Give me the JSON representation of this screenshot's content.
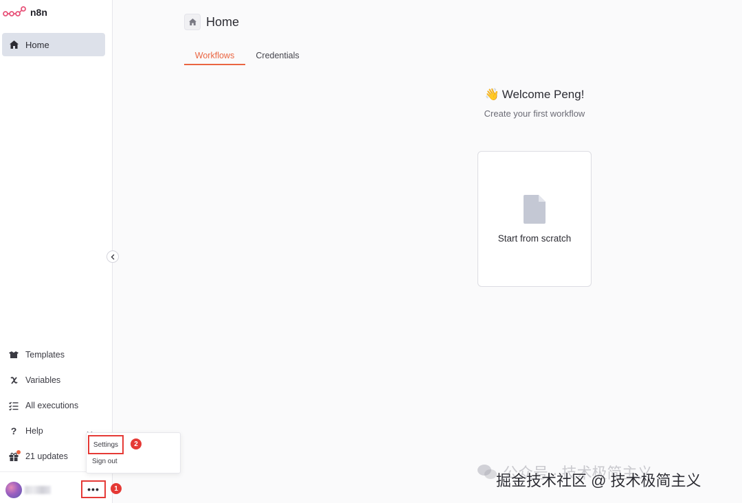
{
  "brand": {
    "name": "n8n",
    "accent": "#ea6541",
    "logo_color": "#e8547a"
  },
  "sidebar": {
    "home_label": "Home",
    "bottom_items": [
      {
        "label": "Templates",
        "icon": "box-icon"
      },
      {
        "label": "Variables",
        "icon": "variable-icon"
      },
      {
        "label": "All executions",
        "icon": "list-check-icon"
      },
      {
        "label": "Help",
        "icon": "question-icon"
      },
      {
        "label": "21 updates",
        "icon": "gift-icon"
      }
    ],
    "more_label": "•••"
  },
  "user_menu": {
    "settings_label": "Settings",
    "signout_label": "Sign out"
  },
  "markers": {
    "first": "1",
    "second": "2"
  },
  "page": {
    "title": "Home",
    "tabs": [
      {
        "label": "Workflows",
        "active": true
      },
      {
        "label": "Credentials",
        "active": false
      }
    ]
  },
  "welcome": {
    "emoji": "👋",
    "title": "Welcome Peng!",
    "subtitle": "Create your first workflow",
    "card_label": "Start from scratch"
  },
  "watermark": {
    "line1": "公众号 · 技术极简主义",
    "line2": "掘金技术社区 @ 技术极简主义"
  }
}
